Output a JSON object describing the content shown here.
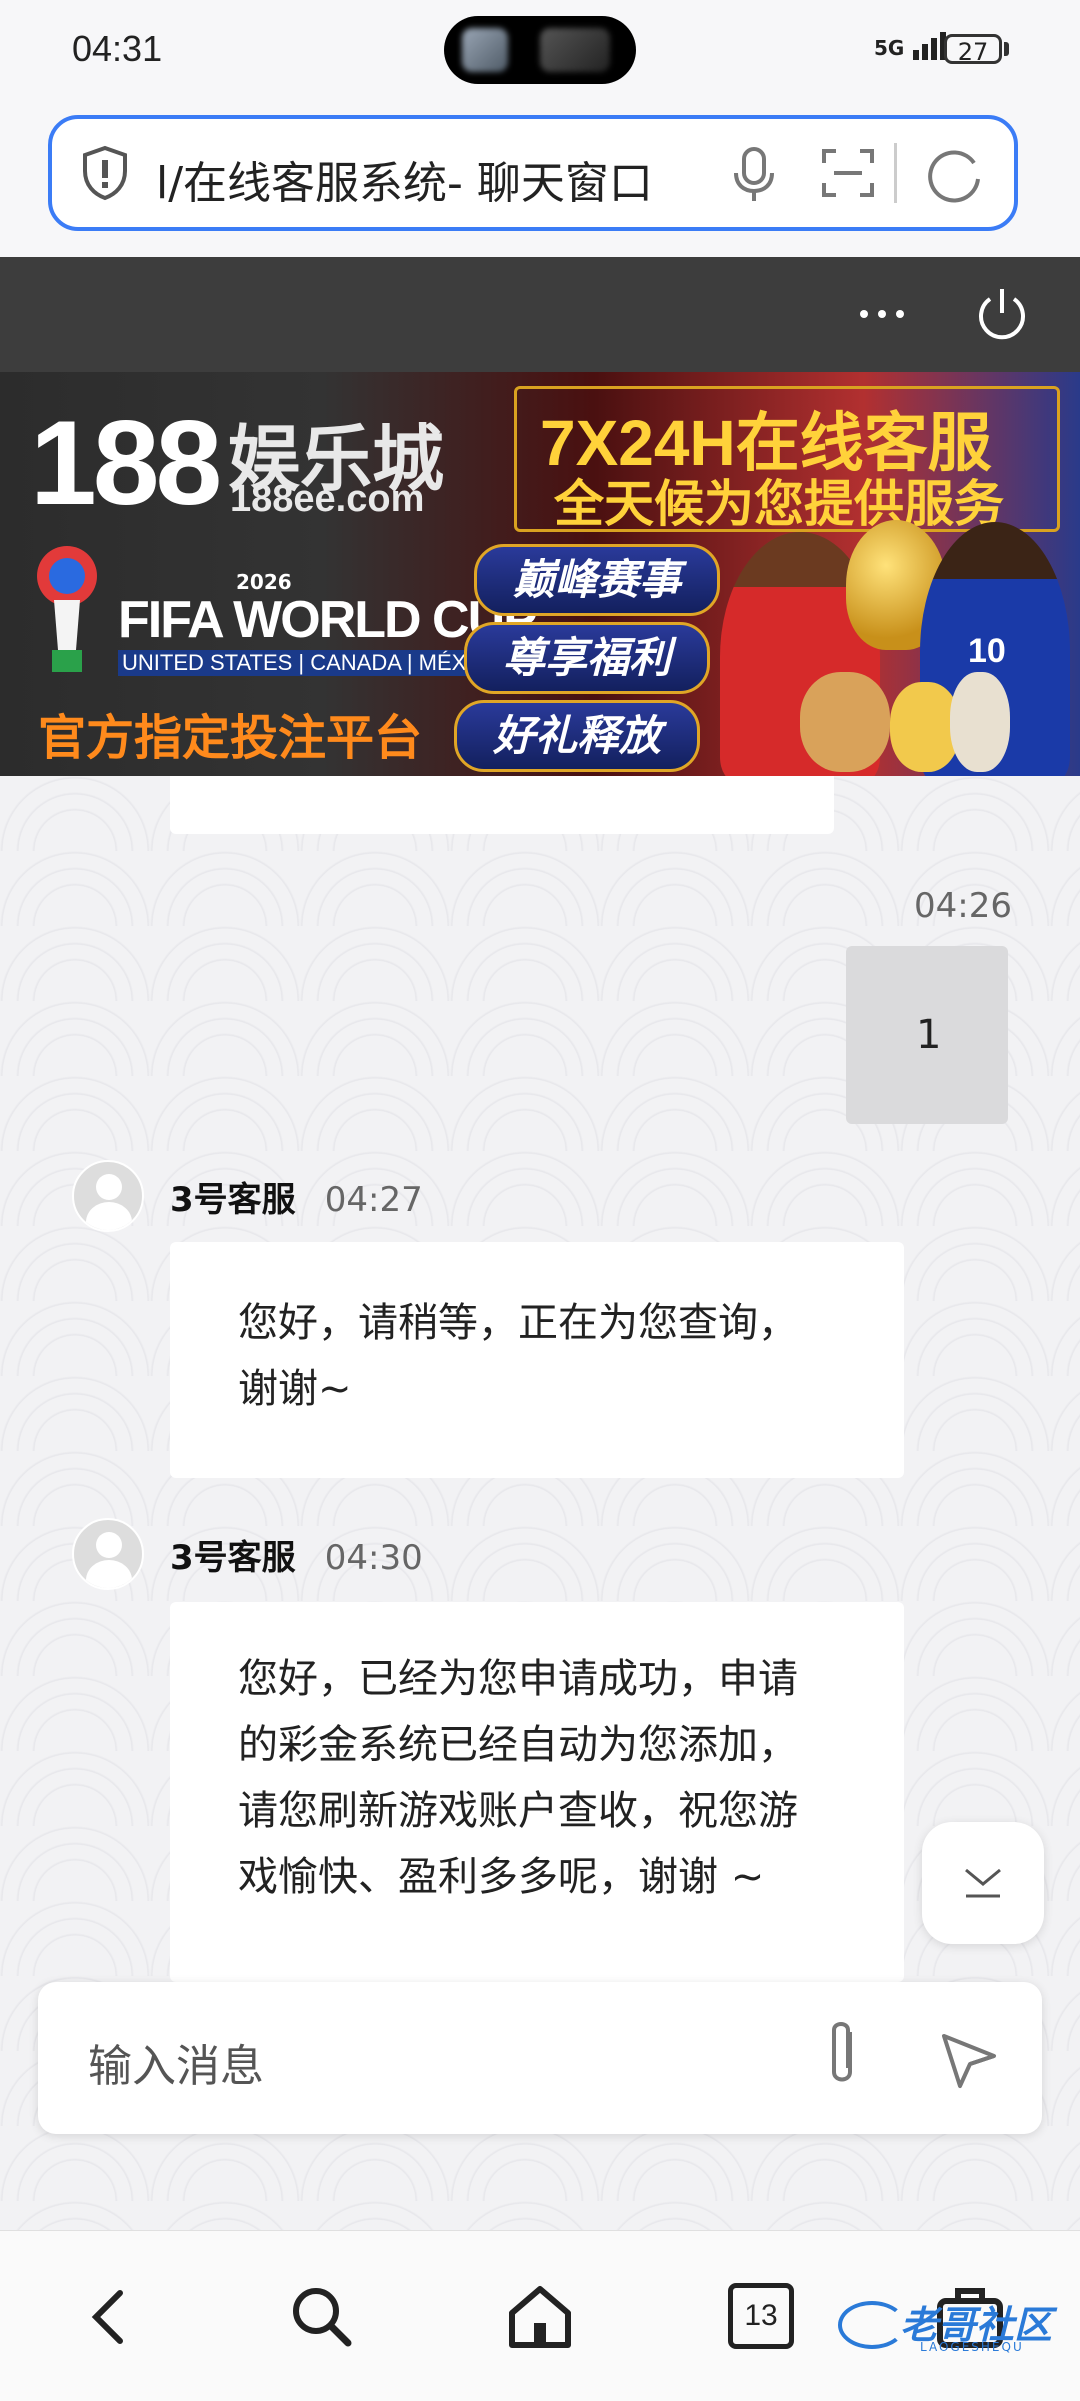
{
  "status_bar": {
    "time": "04:31",
    "network": "5G",
    "battery": "27"
  },
  "browser": {
    "url": "l/在线客服系统- 聊天窗口"
  },
  "banner": {
    "brand_number": "188",
    "brand_name": "娱乐城",
    "domain": "188ee.com",
    "event_year": "2026",
    "event_name": "FIFA WORLD CUP",
    "event_hosts": "UNITED STATES | CANADA | MÉXICO",
    "official_slogan": "官方指定投注平台",
    "service_line1": "7X24H在线客服",
    "service_line2": "全天候为您提供服务",
    "pills": [
      "巅峰赛事",
      "尊享福利",
      "好礼释放"
    ],
    "player_number": "10"
  },
  "messages": [
    {
      "side": "user",
      "time": "04:26",
      "text": "1"
    },
    {
      "side": "agent",
      "sender": "3号客服",
      "time": "04:27",
      "lines": [
        "您好，请稍等，正在为您查询，",
        "谢谢~"
      ]
    },
    {
      "side": "agent",
      "sender": "3号客服",
      "time": "04:30",
      "lines": [
        "您好，已经为您申请成功，申请",
        "的彩金系统已经自动为您添加，",
        "请您刷新游戏账户查收，祝您游",
        "戏愉快、盈利多多呢，谢谢 ~"
      ]
    }
  ],
  "input": {
    "placeholder": "输入消息"
  },
  "nav": {
    "tab_count": "13"
  },
  "watermark": {
    "text": "老哥社区",
    "sub": "LAOGESHEQU"
  },
  "colors": {
    "accent": "#3b7cf6",
    "header": "#3d3d3d",
    "banner_gold": "#ffd23a",
    "banner_orange": "#ff8a1c"
  }
}
